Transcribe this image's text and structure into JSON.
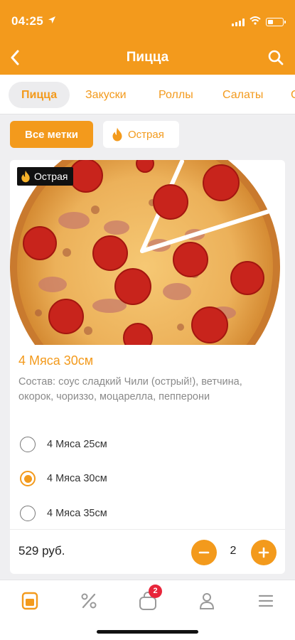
{
  "status_bar": {
    "time": "04:25"
  },
  "header": {
    "title": "Пицца"
  },
  "tabs": [
    {
      "label": "Пицца",
      "active": true
    },
    {
      "label": "Закуски",
      "active": false
    },
    {
      "label": "Роллы",
      "active": false
    },
    {
      "label": "Салаты",
      "active": false
    },
    {
      "label": "С",
      "active": false
    }
  ],
  "filters": {
    "all_label": "Все метки",
    "spicy_label": "Острая"
  },
  "product": {
    "badge": "Острая",
    "name": "4 Мяса 30см",
    "description": "Состав: соус сладкий Чили (острый!), ветчина, окорок, чориззо, моцарелла, пепперони",
    "options": [
      {
        "label": "4 Мяса 25см",
        "selected": false
      },
      {
        "label": "4 Мяса 30см",
        "selected": true
      },
      {
        "label": "4 Мяса 35см",
        "selected": false
      }
    ],
    "price": "529 руб.",
    "quantity": "2"
  },
  "bottom_nav": {
    "cart_count": "2"
  },
  "colors": {
    "accent": "#f39a1c",
    "badge_red": "#e8253a",
    "background": "#efeff1"
  }
}
